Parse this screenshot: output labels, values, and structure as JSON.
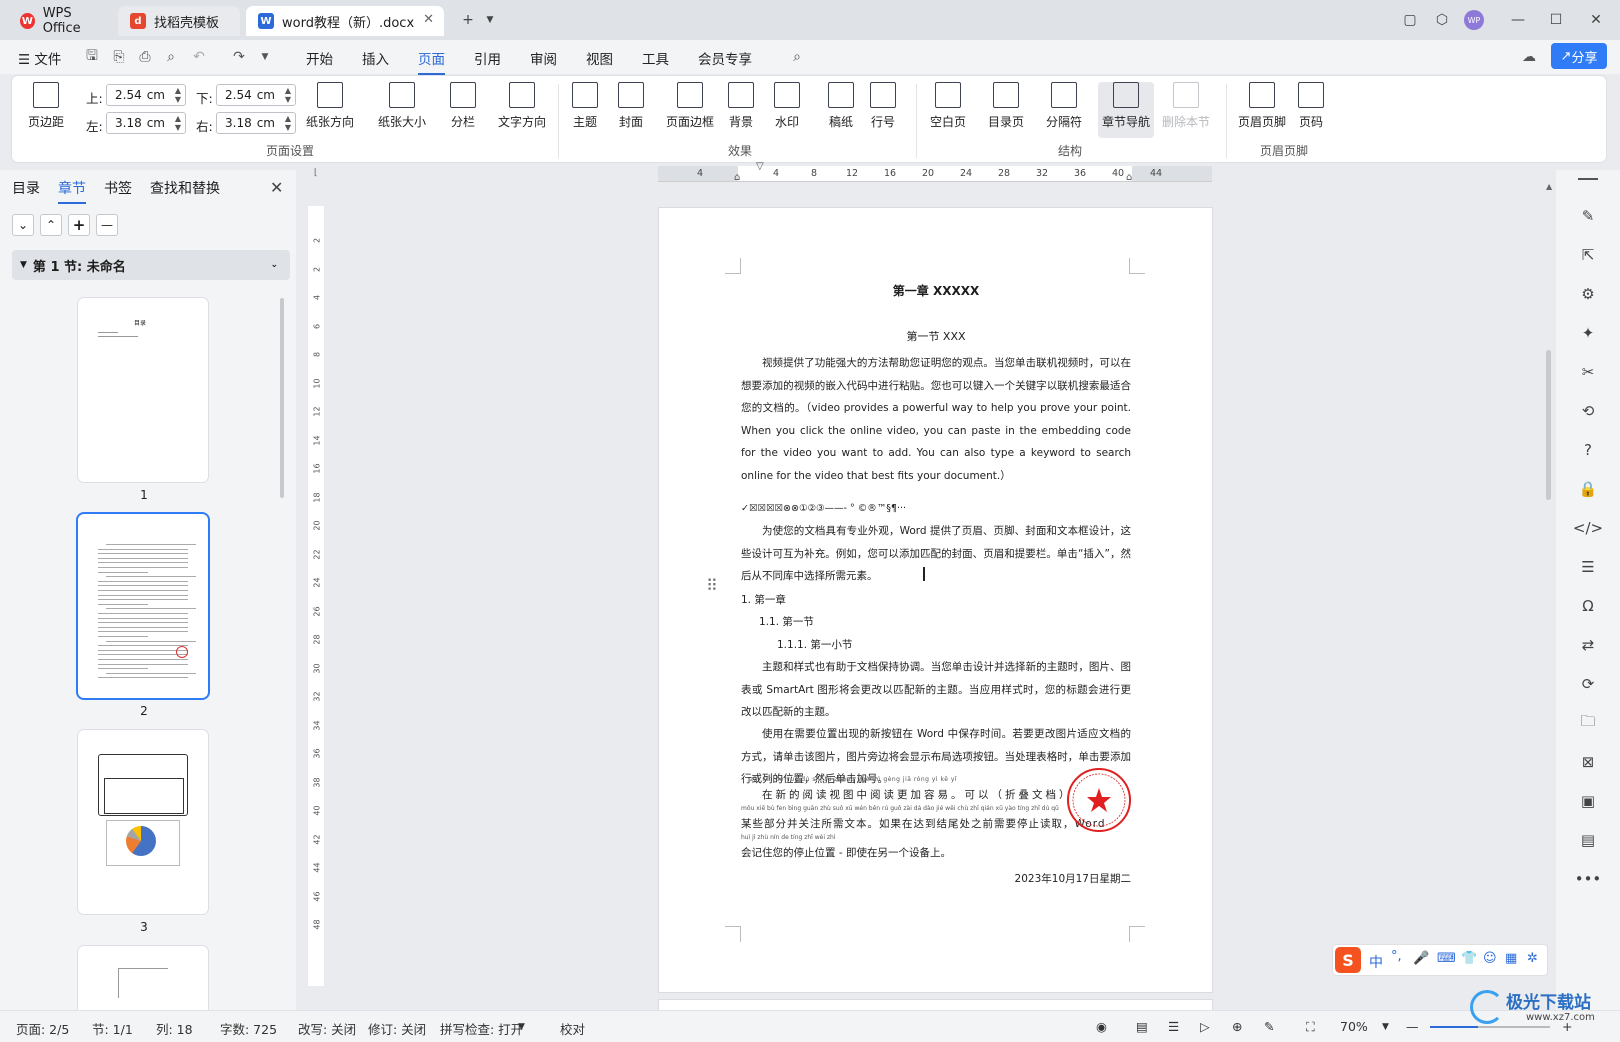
{
  "tabs": [
    {
      "label": "WPS Office"
    },
    {
      "label": "找稻壳模板"
    },
    {
      "label": "word教程（新）.docx"
    }
  ],
  "menu": {
    "file": "文件",
    "items": [
      "开始",
      "插入",
      "页面",
      "引用",
      "审阅",
      "视图",
      "工具",
      "会员专享"
    ],
    "active": "页面",
    "share": "分享"
  },
  "ribbon": {
    "margins_label": "页边距",
    "top_label": "上:",
    "top_value": "2.54",
    "bottom_label": "下:",
    "bottom_value": "2.54",
    "left_label": "左:",
    "left_value": "3.18",
    "right_label": "右:",
    "right_value": "3.18",
    "unit": "cm",
    "btns": [
      "纸张方向",
      "纸张大小",
      "分栏",
      "文字方向",
      "主题",
      "封面",
      "页面边框",
      "背景",
      "水印",
      "稿纸",
      "行号",
      "空白页",
      "目录页",
      "分隔符",
      "章节导航",
      "删除本节",
      "页眉页脚",
      "页码"
    ],
    "groups": [
      "页面设置",
      "效果",
      "结构",
      "页眉页脚"
    ]
  },
  "sidebar": {
    "tabs": [
      "目录",
      "章节",
      "书签",
      "查找和替换"
    ],
    "active_tab": "章节",
    "section_title": "第 1 节: 未命名",
    "pages": [
      "1",
      "2",
      "3"
    ],
    "thumb1_title": "目录"
  },
  "ruler": {
    "h": [
      "4",
      "4",
      "8",
      "12",
      "16",
      "20",
      "24",
      "28",
      "32",
      "36",
      "40",
      "44"
    ],
    "v": [
      "2",
      "2",
      "4",
      "6",
      "8",
      "10",
      "12",
      "14",
      "16",
      "18",
      "20",
      "22",
      "24",
      "26",
      "28",
      "30",
      "32",
      "34",
      "36",
      "38",
      "40",
      "42",
      "44",
      "46",
      "48"
    ]
  },
  "document": {
    "chapter": "第一章  XXXXX",
    "section": "第一节  XXX",
    "p1": "视频提供了功能强大的方法帮助您证明您的观点。当您单击联机视频时，可以在想要添加的视频的嵌入代码中进行粘贴。您也可以键入一个关键字以联机搜索最适合您的文档的。（video provides a powerful way to help you prove your point. When you click the online video, you can paste in the embedding code for the video you want to add. You can also type a keyword to search online for the video that best fits your document.）",
    "symbols": "✓☒☒☒☒⊗⊗①②③——-  °  ©®™§¶···",
    "p2": "为使您的文档具有专业外观，Word 提供了页眉、页脚、封面和文本框设计，这些设计可互为补充。例如，您可以添加匹配的封面、页眉和提要栏。单击“插入”，然后从不同库中选择所需元素。",
    "h1": "1.  第一章",
    "h2": "1.1.  第一节",
    "h3": "1.1.1.  第一小节",
    "p3": "主题和样式也有助于文档保持协调。当您单击设计并选择新的主题时，图片、图表或 SmartArt 图形将会更改以匹配新的主题。当应用样式时，您的标题会进行更改以匹配新的主题。",
    "p4": "使用在需要位置出现的新按钮在 Word 中保存时间。若要更改图片适应文档的方式，请单击该图片，图片旁边将会显示布局选项按钮。当处理表格时，单击要添加行或列的位置，然后单击加号。",
    "pinyin1": "zài xīn de yuè dú shì tú zhōng yuè dú gèng jiā róng yì   kě yǐ",
    "p5": "在新的阅读视图中阅读更加容易。可以（折叠文档）",
    "pinyin2": "mǒu xiē bù fen bìng guān zhù suǒ xū wén běn   rú guǒ zài dá dào jié wěi chù zhī qián xū yào tíng zhǐ dú qǔ",
    "p6": "某些部分并关注所需文本。如果在达到结尾处之前需要停止读取，Word",
    "pinyin3": "huì jì zhù nín de tíng zhǐ wèi zhì",
    "p7": "会记住您的停止位置 - 即使在另一个设备上。",
    "date": "2023年10月17日星期二",
    "seal_text": "测试XX有限公司（测试专用）"
  },
  "statusbar": {
    "page": "页面: 2/5",
    "section": "节: 1/1",
    "column": "列: 18",
    "words": "字数: 725",
    "revise": "改写: 关闭",
    "track": "修订: 关闭",
    "spell": "拼写检查: 打开",
    "proof": "校对",
    "zoom": "70%"
  },
  "ime": {
    "mode": "中"
  },
  "watermark": {
    "text": "极光下载站",
    "url": "www.xz7.com"
  }
}
